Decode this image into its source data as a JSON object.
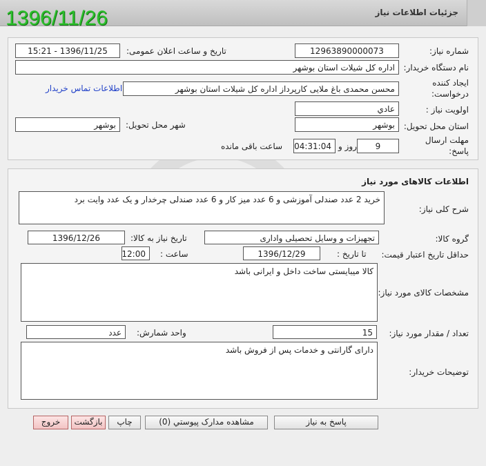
{
  "header": {
    "title": "جزئیات اطلاعات نیاز",
    "date_stamp": "1396/11/26"
  },
  "info": {
    "need_number_label": "شماره نیاز:",
    "need_number": "12963890000073",
    "announce_label": "تاریخ و ساعت اعلان عمومی:",
    "announce_value": "1396/11/25 - 15:21",
    "buyer_label": "نام دستگاه خریدار:",
    "buyer_value": "اداره کل شیلات استان بوشهر",
    "creator_label_1": "ایجاد کننده",
    "creator_label_2": "درخواست:",
    "creator_value": "محسن محمدی باغ ملایی کارپرداز اداره کل شیلات استان بوشهر",
    "contact_link": "اطلاعات تماس خریدار",
    "priority_label": "اولویت نیاز :",
    "priority_value": "عادي",
    "province_label": "استان محل تحویل:",
    "province_value": "بوشهر",
    "city_label": "شهر محل تحویل:",
    "city_value": "بوشهر",
    "deadline_label_1": "مهلت ارسال",
    "deadline_label_2": "پاسخ:",
    "days_value": "9",
    "days_label": "روز و",
    "time_value": "04:31:04",
    "remaining_label": "ساعت باقی مانده"
  },
  "goods": {
    "section_title": "اطلاعات کالاهای مورد نیاز",
    "summary_label": "شرح کلی نیاز:",
    "summary_value": "خرید 2 عدد صندلی آموزشی و 6 عدد میز کار و 6 عدد صندلی چرخدار و یک عدد وایت برد",
    "group_label": "گروه کالا:",
    "group_value": "تجهیزات و وسایل تحصیلی واداری",
    "need_date_label": "تاریخ نیاز به کالا:",
    "need_date_value": "1396/12/26",
    "validity_label": "حداقل تاریخ اعتبار قیمت:",
    "until_label": "تا تاریخ :",
    "until_value": "1396/12/29",
    "hour_label": "ساعت :",
    "hour_value": "12:00",
    "specs_label": "مشخصات کالای مورد نیاز:",
    "specs_value": "کالا میبایستی ساخت داخل و ایرانی باشد",
    "qty_label": "تعداد / مقدار مورد نیاز:",
    "qty_value": "15",
    "unit_label": "واحد شمارش:",
    "unit_value": "عدد",
    "notes_label": "توضیحات خریدار:",
    "notes_value": "دارای گارانتی و خدمات پس از فروش باشد"
  },
  "buttons": {
    "reply": "پاسخ به نیاز",
    "attachments": "مشاهده مدارک پیوستي (0)",
    "print": "چاپ",
    "back": "بازگشت",
    "exit": "خروج"
  },
  "colors": {
    "date_stamp": "#2bbf2b",
    "link": "#2040c8",
    "exit_button": "#f2c4c4"
  }
}
